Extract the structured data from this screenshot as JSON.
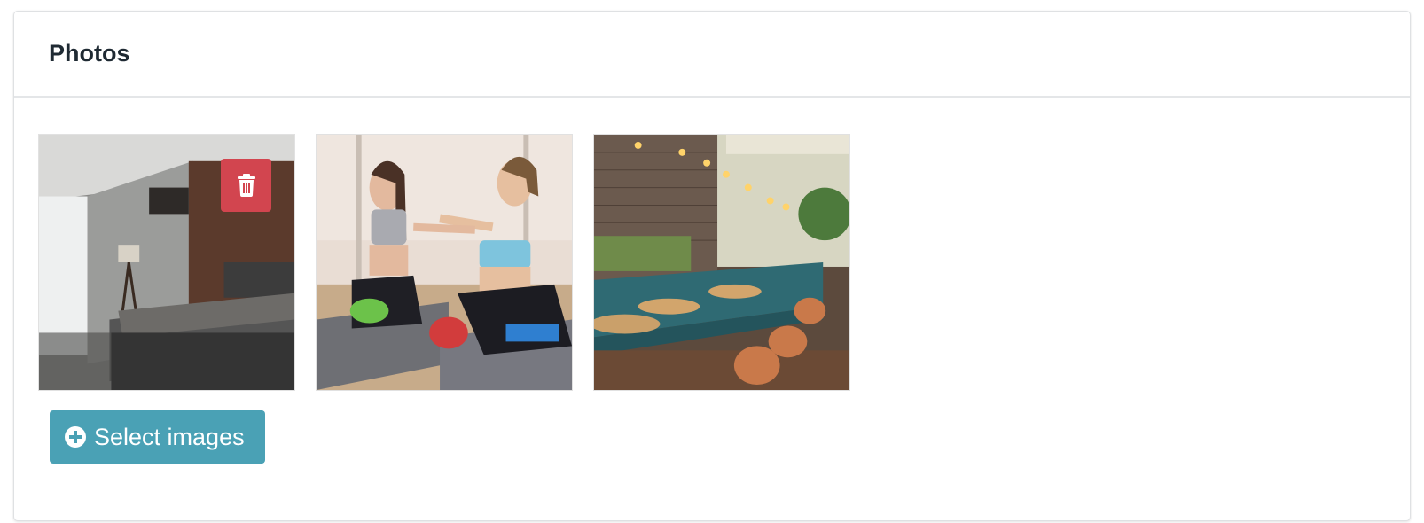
{
  "card": {
    "title": "Photos"
  },
  "photos": [
    {
      "id": "bedroom",
      "icon": "trash-icon",
      "has_delete": true
    },
    {
      "id": "fitness",
      "has_delete": false
    },
    {
      "id": "restaurant",
      "has_delete": false
    }
  ],
  "actions": {
    "select_label": "Select images",
    "select_icon": "plus-circle-icon"
  },
  "colors": {
    "delete": "#d2454f",
    "select": "#4aa1b5"
  }
}
